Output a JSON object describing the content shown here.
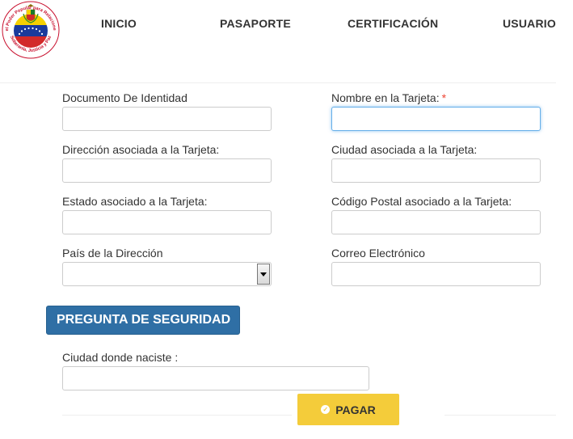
{
  "header": {
    "logo": {
      "ring_text": "Ministerio del Poder Popular para Relaciones Exteriores",
      "bottom_text": "Soberanía, Justicia y Paz",
      "colors": {
        "yellow": "#f6d100",
        "blue": "#1a3a9c",
        "red": "#d22a2a",
        "ring": "#c8102e"
      }
    },
    "nav": [
      {
        "label": "INICIO"
      },
      {
        "label": "PASAPORTE"
      },
      {
        "label": "CERTIFICACIÓN"
      },
      {
        "label": "USUARIO"
      }
    ]
  },
  "form": {
    "fields": {
      "documento": {
        "label": "Documento De Identidad",
        "value": ""
      },
      "nombre": {
        "label": "Nombre en la Tarjeta:",
        "required_mark": "*",
        "value": ""
      },
      "direccion": {
        "label": "Dirección asociada a la Tarjeta:",
        "value": ""
      },
      "ciudad": {
        "label": "Ciudad asociada a la Tarjeta:",
        "value": ""
      },
      "estado": {
        "label": "Estado asociado a la Tarjeta:",
        "value": ""
      },
      "codigo_postal": {
        "label": "Código Postal asociado a la Tarjeta:",
        "value": ""
      },
      "pais": {
        "label": "País de la Dirección",
        "value": ""
      },
      "correo": {
        "label": "Correo Electrónico",
        "value": ""
      }
    },
    "security": {
      "button_label": "PREGUNTA DE SEGURIDAD",
      "question_label": "Ciudad donde naciste :",
      "answer_value": ""
    },
    "pay_button_label": "PAGAR"
  },
  "colors": {
    "primary_blue": "#2f6fa5",
    "pay_yellow": "#f4cc3a",
    "required_red": "#e43",
    "focus_blue": "#66afe9"
  }
}
